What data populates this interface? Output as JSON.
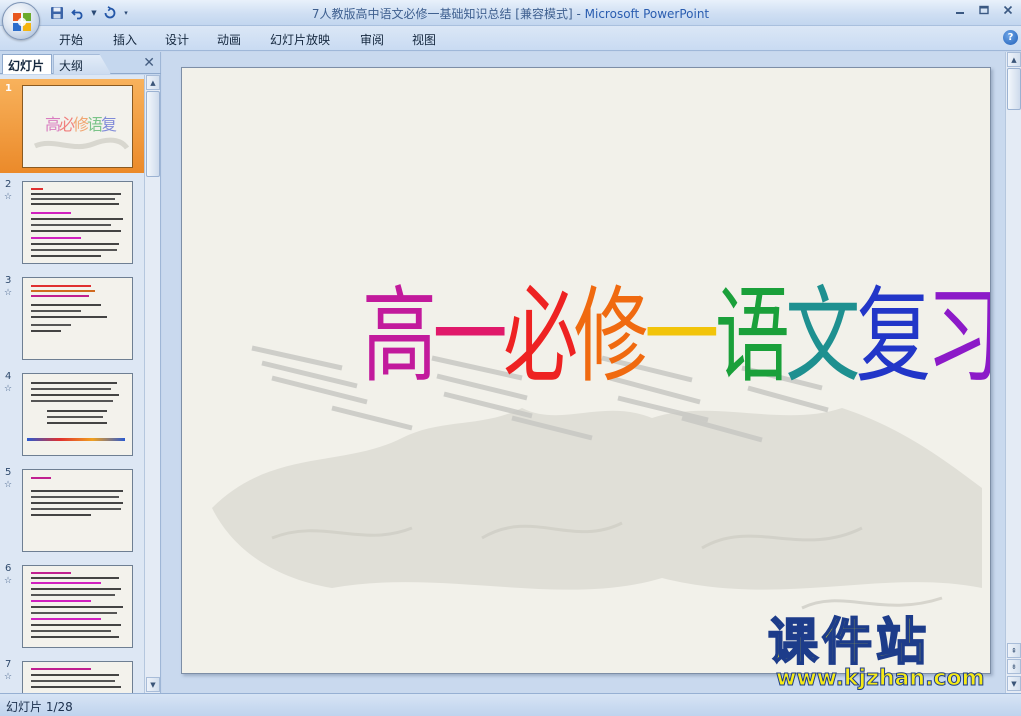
{
  "window": {
    "title_doc": "7人教版高中语文必修一基础知识总结 [兼容模式]",
    "title_sep": " - ",
    "title_app": "Microsoft PowerPoint"
  },
  "ribbon": {
    "tabs": [
      "开始",
      "插入",
      "设计",
      "动画",
      "幻灯片放映",
      "审阅",
      "视图"
    ]
  },
  "left_pane": {
    "tabs": [
      "幻灯片",
      "大纲"
    ],
    "slides": [
      {
        "number": "1",
        "selected": true
      },
      {
        "number": "2",
        "star": "☆"
      },
      {
        "number": "3",
        "star": "☆"
      },
      {
        "number": "4",
        "star": "☆"
      },
      {
        "number": "5",
        "star": "☆"
      },
      {
        "number": "6",
        "star": "☆"
      },
      {
        "number": "7",
        "star": "☆"
      }
    ]
  },
  "slide": {
    "title_chars": [
      "高",
      "一",
      "必",
      "修",
      "一",
      "语",
      "文",
      "复",
      "习"
    ],
    "title_colors": [
      "#c21a9c",
      "#e0196a",
      "#ee2222",
      "#f06a10",
      "#f2c40a",
      "#1aa03a",
      "#1e9090",
      "#2236c8",
      "#8c1ac8"
    ]
  },
  "status": {
    "slide_indicator": "幻灯片 1/28"
  },
  "watermark": {
    "brand": "课件站",
    "url": "www.kjzhan.com"
  }
}
